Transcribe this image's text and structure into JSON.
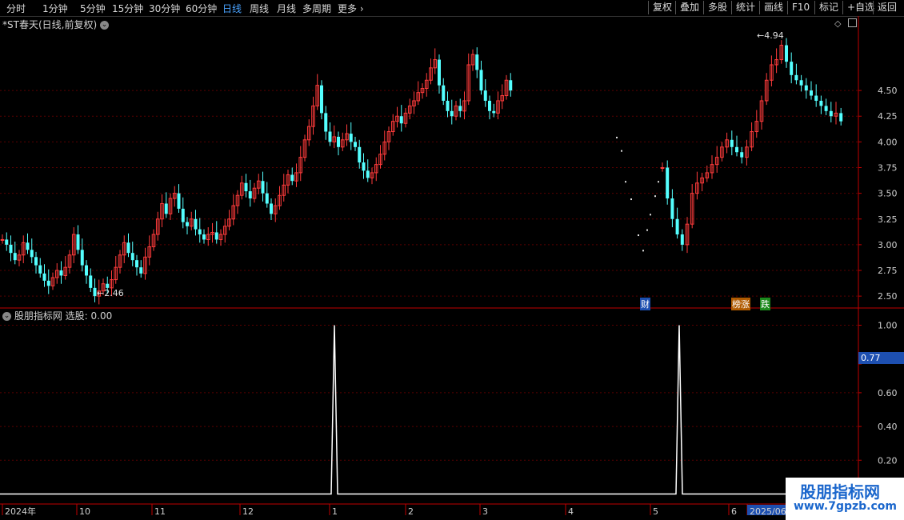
{
  "toolbar": {
    "periods": [
      "分时",
      "1分钟",
      "5分钟",
      "15分钟",
      "30分钟",
      "60分钟",
      "日线",
      "周线",
      "月线",
      "多周期",
      "更多"
    ],
    "active_period": "日线",
    "more_arrow": "›",
    "buttons": [
      "复权",
      "叠加",
      "多股",
      "统计",
      "画线",
      "F10",
      "标记",
      "+自选",
      "返回"
    ]
  },
  "main_chart": {
    "title": "*ST春天(日线,前复权)",
    "high_label": "4.94",
    "low_label": "2.46",
    "tag_cai": "财",
    "tag_bangzhang": "榜涨",
    "tag_die": "跌"
  },
  "indicator": {
    "title": "股朋指标网 选股: 0.00",
    "current_value": "0.77"
  },
  "watermark": {
    "title": "股朋指标网",
    "url": "www.7gpzb.com"
  },
  "colors": {
    "up": "#ff3b3b",
    "down": "#54ffff",
    "axis": "#c00000",
    "grid": "#5a0000",
    "indicator_line": "#ffffff",
    "value_box": "#1d4fb0"
  },
  "chart_data": [
    {
      "type": "candlestick",
      "title": "*ST春天(日线,前复权)",
      "y_ticks": [
        2.5,
        2.75,
        3.0,
        3.25,
        3.5,
        3.75,
        4.0,
        4.25,
        4.5
      ],
      "y_tick_labels": [
        "2.50",
        "2.75",
        "3.00",
        "3.25",
        "3.50",
        "3.75",
        "4.00",
        "4.25",
        "4.50"
      ],
      "ylim": [
        2.4,
        5.1
      ],
      "grid": true,
      "annotations": [
        {
          "text": "4.94",
          "type": "high"
        },
        {
          "text": "2.46",
          "type": "low"
        }
      ],
      "closes": [
        3.05,
        3.0,
        2.92,
        2.85,
        2.9,
        3.02,
        2.95,
        2.88,
        2.8,
        2.72,
        2.65,
        2.6,
        2.68,
        2.75,
        2.7,
        2.78,
        2.9,
        3.1,
        2.95,
        2.8,
        2.7,
        2.58,
        2.5,
        2.55,
        2.62,
        2.58,
        2.66,
        2.78,
        2.9,
        3.02,
        2.92,
        2.85,
        2.78,
        2.72,
        2.88,
        2.98,
        3.1,
        3.25,
        3.4,
        3.3,
        3.45,
        3.5,
        3.35,
        3.22,
        3.18,
        3.25,
        3.15,
        3.1,
        3.05,
        3.1,
        3.12,
        3.05,
        3.1,
        3.18,
        3.25,
        3.38,
        3.48,
        3.6,
        3.52,
        3.45,
        3.55,
        3.62,
        3.5,
        3.4,
        3.3,
        3.38,
        3.48,
        3.58,
        3.68,
        3.62,
        3.7,
        3.85,
        4.02,
        4.15,
        4.35,
        4.55,
        4.28,
        4.1,
        4.0,
        4.05,
        3.95,
        4.02,
        4.08,
        4.0,
        3.95,
        3.8,
        3.72,
        3.65,
        3.7,
        3.78,
        3.88,
        4.0,
        4.1,
        4.2,
        4.25,
        4.18,
        4.28,
        4.35,
        4.4,
        4.48,
        4.52,
        4.6,
        4.72,
        4.8,
        4.55,
        4.4,
        4.3,
        4.25,
        4.35,
        4.3,
        4.4,
        4.75,
        4.85,
        4.7,
        4.5,
        4.4,
        4.3,
        4.28,
        4.4,
        4.45,
        4.6,
        4.5
      ],
      "closes_after_gap": [
        3.75,
        3.45,
        3.25,
        3.1,
        3.0,
        3.2,
        3.5,
        3.6,
        3.65,
        3.7,
        3.78,
        3.85,
        3.95,
        4.02,
        3.95,
        3.9,
        3.85,
        3.95,
        4.1,
        4.2,
        4.4,
        4.6,
        4.75,
        4.8,
        4.94,
        4.78,
        4.65,
        4.6,
        4.55,
        4.5,
        4.45,
        4.4,
        4.35,
        4.3,
        4.25,
        4.28,
        4.2
      ]
    },
    {
      "type": "line",
      "title": "股朋指标网 选股: 0.00",
      "y_ticks": [
        0.2,
        0.4,
        0.6,
        0.77,
        1.0
      ],
      "y_tick_labels": [
        "0.20",
        "0.40",
        "0.60",
        "0.77",
        "1.00"
      ],
      "ylim": [
        -0.05,
        1.05
      ],
      "signals": [
        {
          "x_label": "1",
          "value": 1.0
        },
        {
          "x_label": "5",
          "value": 1.0
        }
      ],
      "x_labels": [
        "2024年",
        "10",
        "11",
        "12",
        "1",
        "2",
        "3",
        "4",
        "5",
        "6",
        "2025/06/"
      ]
    }
  ]
}
